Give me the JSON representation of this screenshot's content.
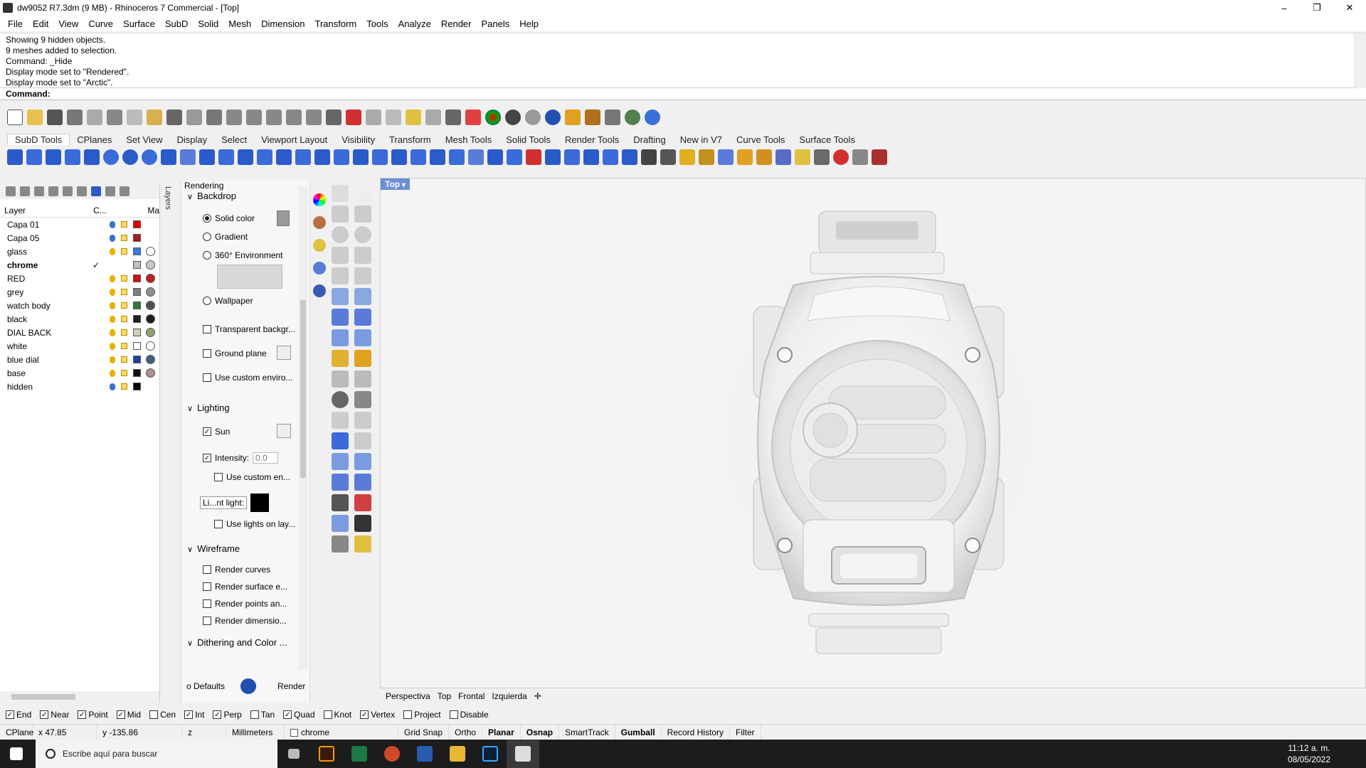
{
  "window": {
    "title": "dw9052 R7.3dm (9 MB) - Rhinoceros 7 Commercial - [Top]"
  },
  "menu": [
    "File",
    "Edit",
    "View",
    "Curve",
    "Surface",
    "SubD",
    "Solid",
    "Mesh",
    "Dimension",
    "Transform",
    "Tools",
    "Analyze",
    "Render",
    "Panels",
    "Help"
  ],
  "command_history": [
    "Showing 9 hidden objects.",
    "9 meshes added to selection.",
    "Command: _Hide",
    "Display mode set to \"Rendered\".",
    "Display mode set to \"Arctic\"."
  ],
  "command_prompt": "Command:",
  "toolbar_tabs": [
    "SubD Tools",
    "CPlanes",
    "Set View",
    "Display",
    "Select",
    "Viewport Layout",
    "Visibility",
    "Transform",
    "Mesh Tools",
    "Solid Tools",
    "Render Tools",
    "Drafting",
    "New in V7",
    "Curve Tools",
    "Surface Tools"
  ],
  "layers": {
    "headers": {
      "layer": "Layer",
      "current": "C...",
      "material": "Ma"
    },
    "tab_label": "Layers",
    "rows": [
      {
        "name": "Capa 01",
        "color": "#e00000",
        "bulb": "#3a6fd8",
        "mat": "none"
      },
      {
        "name": "Capa 05",
        "color": "#a02020",
        "bulb": "#3a6fd8",
        "mat": "none"
      },
      {
        "name": "glass",
        "color": "#3a7ae0",
        "bulb": "#e8b000",
        "mat": "#ffffff"
      },
      {
        "name": "chrome",
        "color": "#c0c0c0",
        "bulb": "none",
        "mat": "#c8c8c8",
        "current": "✓"
      },
      {
        "name": "RED",
        "color": "#d01010",
        "bulb": "#e8b000",
        "mat": "#c02020"
      },
      {
        "name": "grey",
        "color": "#808080",
        "bulb": "#e8b000",
        "mat": "#909090"
      },
      {
        "name": "watch body",
        "color": "#2f7a3a",
        "bulb": "#e8b000",
        "mat": "#505050"
      },
      {
        "name": "black",
        "color": "#202020",
        "bulb": "#e8b000",
        "mat": "#202020"
      },
      {
        "name": "DIAL BACK",
        "color": "#d0d0b0",
        "bulb": "#e8b000",
        "mat": "#90a070"
      },
      {
        "name": "white",
        "color": "#ffffff",
        "bulb": "#e8b000",
        "mat": "#ffffff"
      },
      {
        "name": "blue dial",
        "color": "#2040a0",
        "bulb": "#e8b000",
        "mat": "#406080"
      },
      {
        "name": "base",
        "color": "#101010",
        "bulb": "#e8b000",
        "mat": "#b09090"
      },
      {
        "name": "hidden",
        "color": "#000000",
        "bulb": "#3a6fd8",
        "mat": "none"
      }
    ]
  },
  "rendering": {
    "panel_title": "Rendering",
    "backdrop": {
      "heading": "Backdrop",
      "solid": "Solid color",
      "gradient": "Gradient",
      "env360": "360° Environment",
      "wallpaper": "Wallpaper",
      "transparent": "Transparent backgr...",
      "ground": "Ground plane",
      "custom_env": "Use custom enviro..."
    },
    "lighting": {
      "heading": "Lighting",
      "sun": "Sun",
      "intensity_label": "Intensity:",
      "intensity_value": "0.0",
      "custom_env": "Use custom en...",
      "light_label": "Li...nt light:",
      "lights_on_layer": "Use lights on lay..."
    },
    "wireframe": {
      "heading": "Wireframe",
      "curves": "Render curves",
      "surface": "Render surface e...",
      "points": "Render points an...",
      "dims": "Render dimensio..."
    },
    "dithering": {
      "heading": "Dithering and Color ..."
    },
    "defaults_btn": "o Defaults",
    "render_btn": "Render"
  },
  "viewport": {
    "label": "Top",
    "tabs": [
      "Perspectiva",
      "Top",
      "Frontal",
      "Izquierda"
    ]
  },
  "osnaps": [
    {
      "label": "End",
      "on": true
    },
    {
      "label": "Near",
      "on": true
    },
    {
      "label": "Point",
      "on": true
    },
    {
      "label": "Mid",
      "on": true
    },
    {
      "label": "Cen",
      "on": false
    },
    {
      "label": "Int",
      "on": true
    },
    {
      "label": "Perp",
      "on": true
    },
    {
      "label": "Tan",
      "on": false
    },
    {
      "label": "Quad",
      "on": true
    },
    {
      "label": "Knot",
      "on": false
    },
    {
      "label": "Vertex",
      "on": true
    },
    {
      "label": "Project",
      "on": false
    },
    {
      "label": "Disable",
      "on": false
    }
  ],
  "status": {
    "cplane": "CPlane",
    "x": "x 47.85",
    "y": "y -135.86",
    "z": "z",
    "units": "Millimeters",
    "layer": "chrome",
    "grid_snap": "Grid Snap",
    "ortho": "Ortho",
    "planar": "Planar",
    "osnap": "Osnap",
    "smarttrack": "SmartTrack",
    "gumball": "Gumball",
    "record_history": "Record History",
    "filter": "Filter"
  },
  "taskbar": {
    "search_placeholder": "Escribe aquí para buscar",
    "time": "11:12 a. m.",
    "date": "08/05/2022"
  }
}
